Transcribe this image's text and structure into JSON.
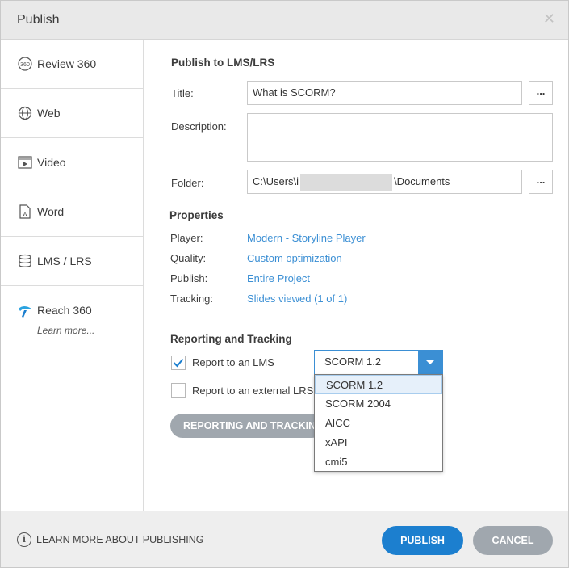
{
  "window": {
    "title": "Publish",
    "close_glyph": "✕"
  },
  "sidebar": {
    "items": [
      {
        "label": "Review 360",
        "icon": "review-360-icon"
      },
      {
        "label": "Web",
        "icon": "globe-icon"
      },
      {
        "label": "Video",
        "icon": "video-icon"
      },
      {
        "label": "Word",
        "icon": "word-document-icon"
      },
      {
        "label": "LMS / LRS",
        "icon": "database-icon",
        "selected": true
      },
      {
        "label": "Reach 360",
        "sub": "Learn more...",
        "icon": "reach-360-icon"
      }
    ]
  },
  "main": {
    "heading": "Publish to LMS/LRS",
    "title_label": "Title:",
    "title_value": "What is SCORM?",
    "title_button": "...",
    "description_label": "Description:",
    "description_value": "",
    "folder_label": "Folder:",
    "folder_prefix": "C:\\Users\\i",
    "folder_suffix": "\\Documents",
    "folder_button": "...",
    "properties": {
      "heading": "Properties",
      "rows": [
        {
          "label": "Player:",
          "value": "Modern - Storyline Player"
        },
        {
          "label": "Quality:",
          "value": "Custom optimization"
        },
        {
          "label": "Publish:",
          "value": "Entire Project"
        },
        {
          "label": "Tracking:",
          "value": "Slides viewed (1 of 1)"
        }
      ]
    },
    "reporting": {
      "heading": "Reporting and Tracking",
      "report_lms_label": "Report to an LMS",
      "report_lms_checked": true,
      "report_lrs_label": "Report to an external LRS",
      "report_lrs_checked": false,
      "standard_selected": "SCORM 1.2",
      "standard_options": [
        "SCORM 1.2",
        "SCORM 2004",
        "AICC",
        "xAPI",
        "cmi5"
      ],
      "button_label": "REPORTING AND TRACKING"
    }
  },
  "footer": {
    "info_glyph": "i",
    "learn_more": "LEARN MORE ABOUT PUBLISHING",
    "publish": "PUBLISH",
    "cancel": "CANCEL"
  },
  "colors": {
    "accent": "#1c7fcf",
    "link": "#3b8fd4",
    "secondary_button": "#a0a7ae"
  }
}
